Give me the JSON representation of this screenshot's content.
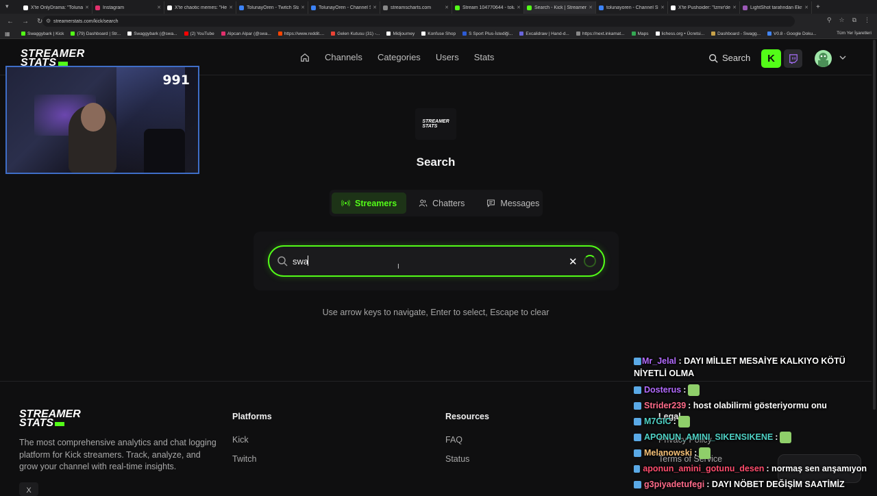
{
  "browser": {
    "tabs": [
      {
        "label": "X'te OnlyDrama: \"Tolunay",
        "color": "#ffffff"
      },
      {
        "label": "Instagram",
        "color": "#e1306c"
      },
      {
        "label": "X'te chaotic memes: \"He",
        "color": "#ffffff"
      },
      {
        "label": "TolunayOren - Twitch Stat",
        "color": "#3b82f6"
      },
      {
        "label": "TolunayOren - Channel St",
        "color": "#3b82f6"
      },
      {
        "label": "streamscharts.com",
        "color": "#888888"
      },
      {
        "label": "Stream 104770644 - tolun",
        "color": "#53fc18"
      },
      {
        "label": "Search - Kick | StreamerSt",
        "color": "#53fc18"
      },
      {
        "label": "tolunayoren - Channel St",
        "color": "#3b82f6"
      },
      {
        "label": "X'te Pushoider: \"İzmir'de",
        "color": "#ffffff"
      },
      {
        "label": "LightShot tarafından Ekra",
        "color": "#9b59b6"
      }
    ],
    "url": "streamerstats.com/kick/search",
    "bookmarks": [
      {
        "label": "Swaggybark | Kick",
        "color": "#53fc18"
      },
      {
        "label": "(79) Dashboard | Str...",
        "color": "#53fc18"
      },
      {
        "label": "Swaggybark (@swa...",
        "color": "#ffffff"
      },
      {
        "label": "(2) YouTube",
        "color": "#ff0000"
      },
      {
        "label": "Alpcan Alpar (@swa...",
        "color": "#e1306c"
      },
      {
        "label": "https://www.reddit....",
        "color": "#ff4500"
      },
      {
        "label": "Gelen Kutusu (31) -...",
        "color": "#ea4335"
      },
      {
        "label": "Midjourney",
        "color": "#ffffff"
      },
      {
        "label": "Konfuse Shop",
        "color": "#ffffff"
      },
      {
        "label": "S Sport Plus-İstediği...",
        "color": "#2d5bd4"
      },
      {
        "label": "Excalidraw | Hand-d...",
        "color": "#6965db"
      },
      {
        "label": "https://next.inkamat...",
        "color": "#888888"
      },
      {
        "label": "Maps",
        "color": "#34a853"
      },
      {
        "label": "lichess.org • Ücretsi...",
        "color": "#ffffff"
      },
      {
        "label": "Dashboard - Swagg...",
        "color": "#c8a24a"
      },
      {
        "label": "V0.8 - Google Doku...",
        "color": "#4285f4"
      }
    ],
    "all_bookmarks": "Tüm Yer İşaretleri"
  },
  "header": {
    "logo_line1": "STREAMER",
    "logo_line2": "STATS",
    "nav": [
      "Channels",
      "Categories",
      "Users",
      "Stats"
    ],
    "search_label": "Search",
    "kick_letter": "K"
  },
  "webcam": {
    "viewer_count": "991"
  },
  "main": {
    "logo_line1": "STREAMER",
    "logo_line2": "STATS",
    "title": "Search",
    "tabs": [
      {
        "label": "Streamers",
        "active": true
      },
      {
        "label": "Chatters",
        "active": false
      },
      {
        "label": "Messages",
        "active": false
      }
    ],
    "search_value": "swa",
    "hint": "Use arrow keys to navigate, Enter to select, Escape to clear"
  },
  "footer": {
    "logo_line1": "STREAMER",
    "logo_line2": "STATS",
    "description": "The most comprehensive analytics and chat logging platform for Kick streamers. Track, analyze, and grow your channel with real-time insights.",
    "platforms_title": "Platforms",
    "platforms": [
      "Kick",
      "Twitch"
    ],
    "resources_title": "Resources",
    "resources": [
      "FAQ",
      "Status"
    ],
    "legal_title": "Legal",
    "legal": [
      "Privacy Policy",
      "Terms of Service"
    ],
    "social_x": "X"
  },
  "chat": [
    {
      "user": "Mr_Jelal",
      "color": "#b36bff",
      "message": ": DAYI MİLLET MESAİYE KALKIYO KÖTÜ NİYETLİ OLMA"
    },
    {
      "user": "Dosterus",
      "color": "#b36bff",
      "message": ":"
    },
    {
      "user": "Strider239",
      "color": "#ff6b8a",
      "message": ": host olabilirmi gösteriyormu onu"
    },
    {
      "user": "M7GIC",
      "color": "#4fd1c5",
      "message": ":"
    },
    {
      "user": "APONUN_AMINI_SIKENSIKENE",
      "color": "#4fd1c5",
      "message": ":"
    },
    {
      "user": "Melanowski",
      "color": "#f6c177",
      "message": ":"
    },
    {
      "user": "aponun_amini_gotunu_desen",
      "color": "#ff4d6d",
      "message": ": normaş sen anşamıyon"
    },
    {
      "user": "g3piyadetufegi",
      "color": "#ff6b8a",
      "message": ": DAYI NÖBET DEĞİŞİM SAATİMİZ"
    }
  ]
}
